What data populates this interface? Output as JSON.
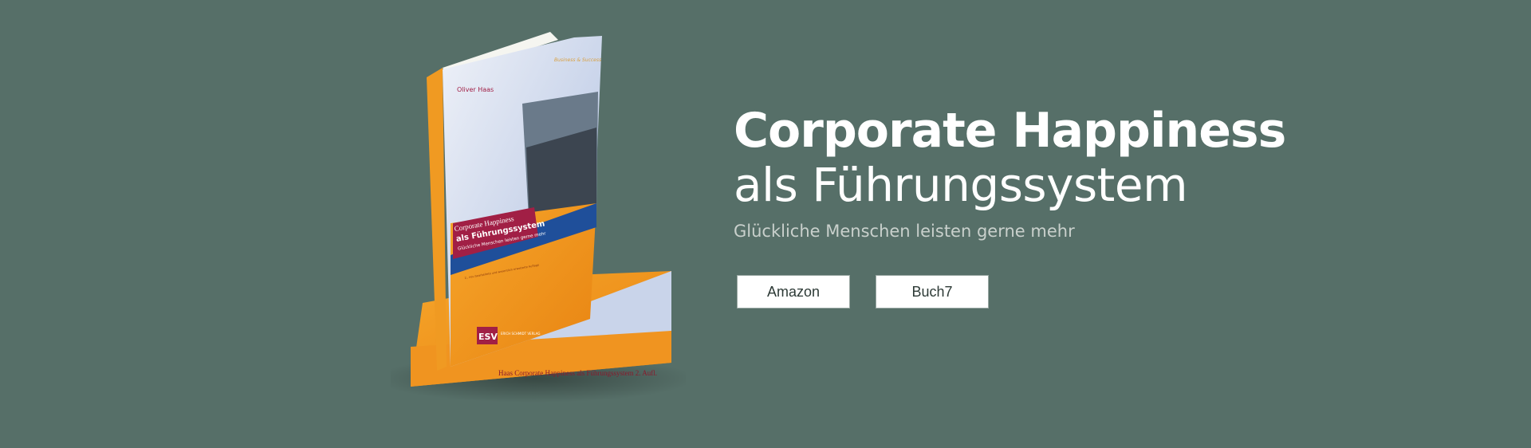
{
  "hero": {
    "title_line1": "Corporate Happiness",
    "title_line2": "als Führungssystem",
    "subtitle": "Glückliche Menschen leisten gerne mehr"
  },
  "buttons": {
    "amazon": "Amazon",
    "buch7": "Buch7"
  },
  "book_cover": {
    "author": "Oliver Haas",
    "series": "Business & Success",
    "title_a": "Corporate Happiness",
    "title_b": "als Führungssystem",
    "subtitle": "Glückliche Menschen leisten gerne mehr",
    "edition": "2., neu bearbeitete und wesentlich erweiterte Auflage",
    "publisher": "ESV",
    "publisher_full": "ERICH SCHMIDT VERLAG",
    "spine": "Haas Corporate Happiness als Führungssystem 2. Aufl."
  },
  "colors": {
    "background": "#566f68",
    "orange": "#f0951c",
    "crimson": "#a11f45",
    "blue": "#1f4f9a"
  }
}
